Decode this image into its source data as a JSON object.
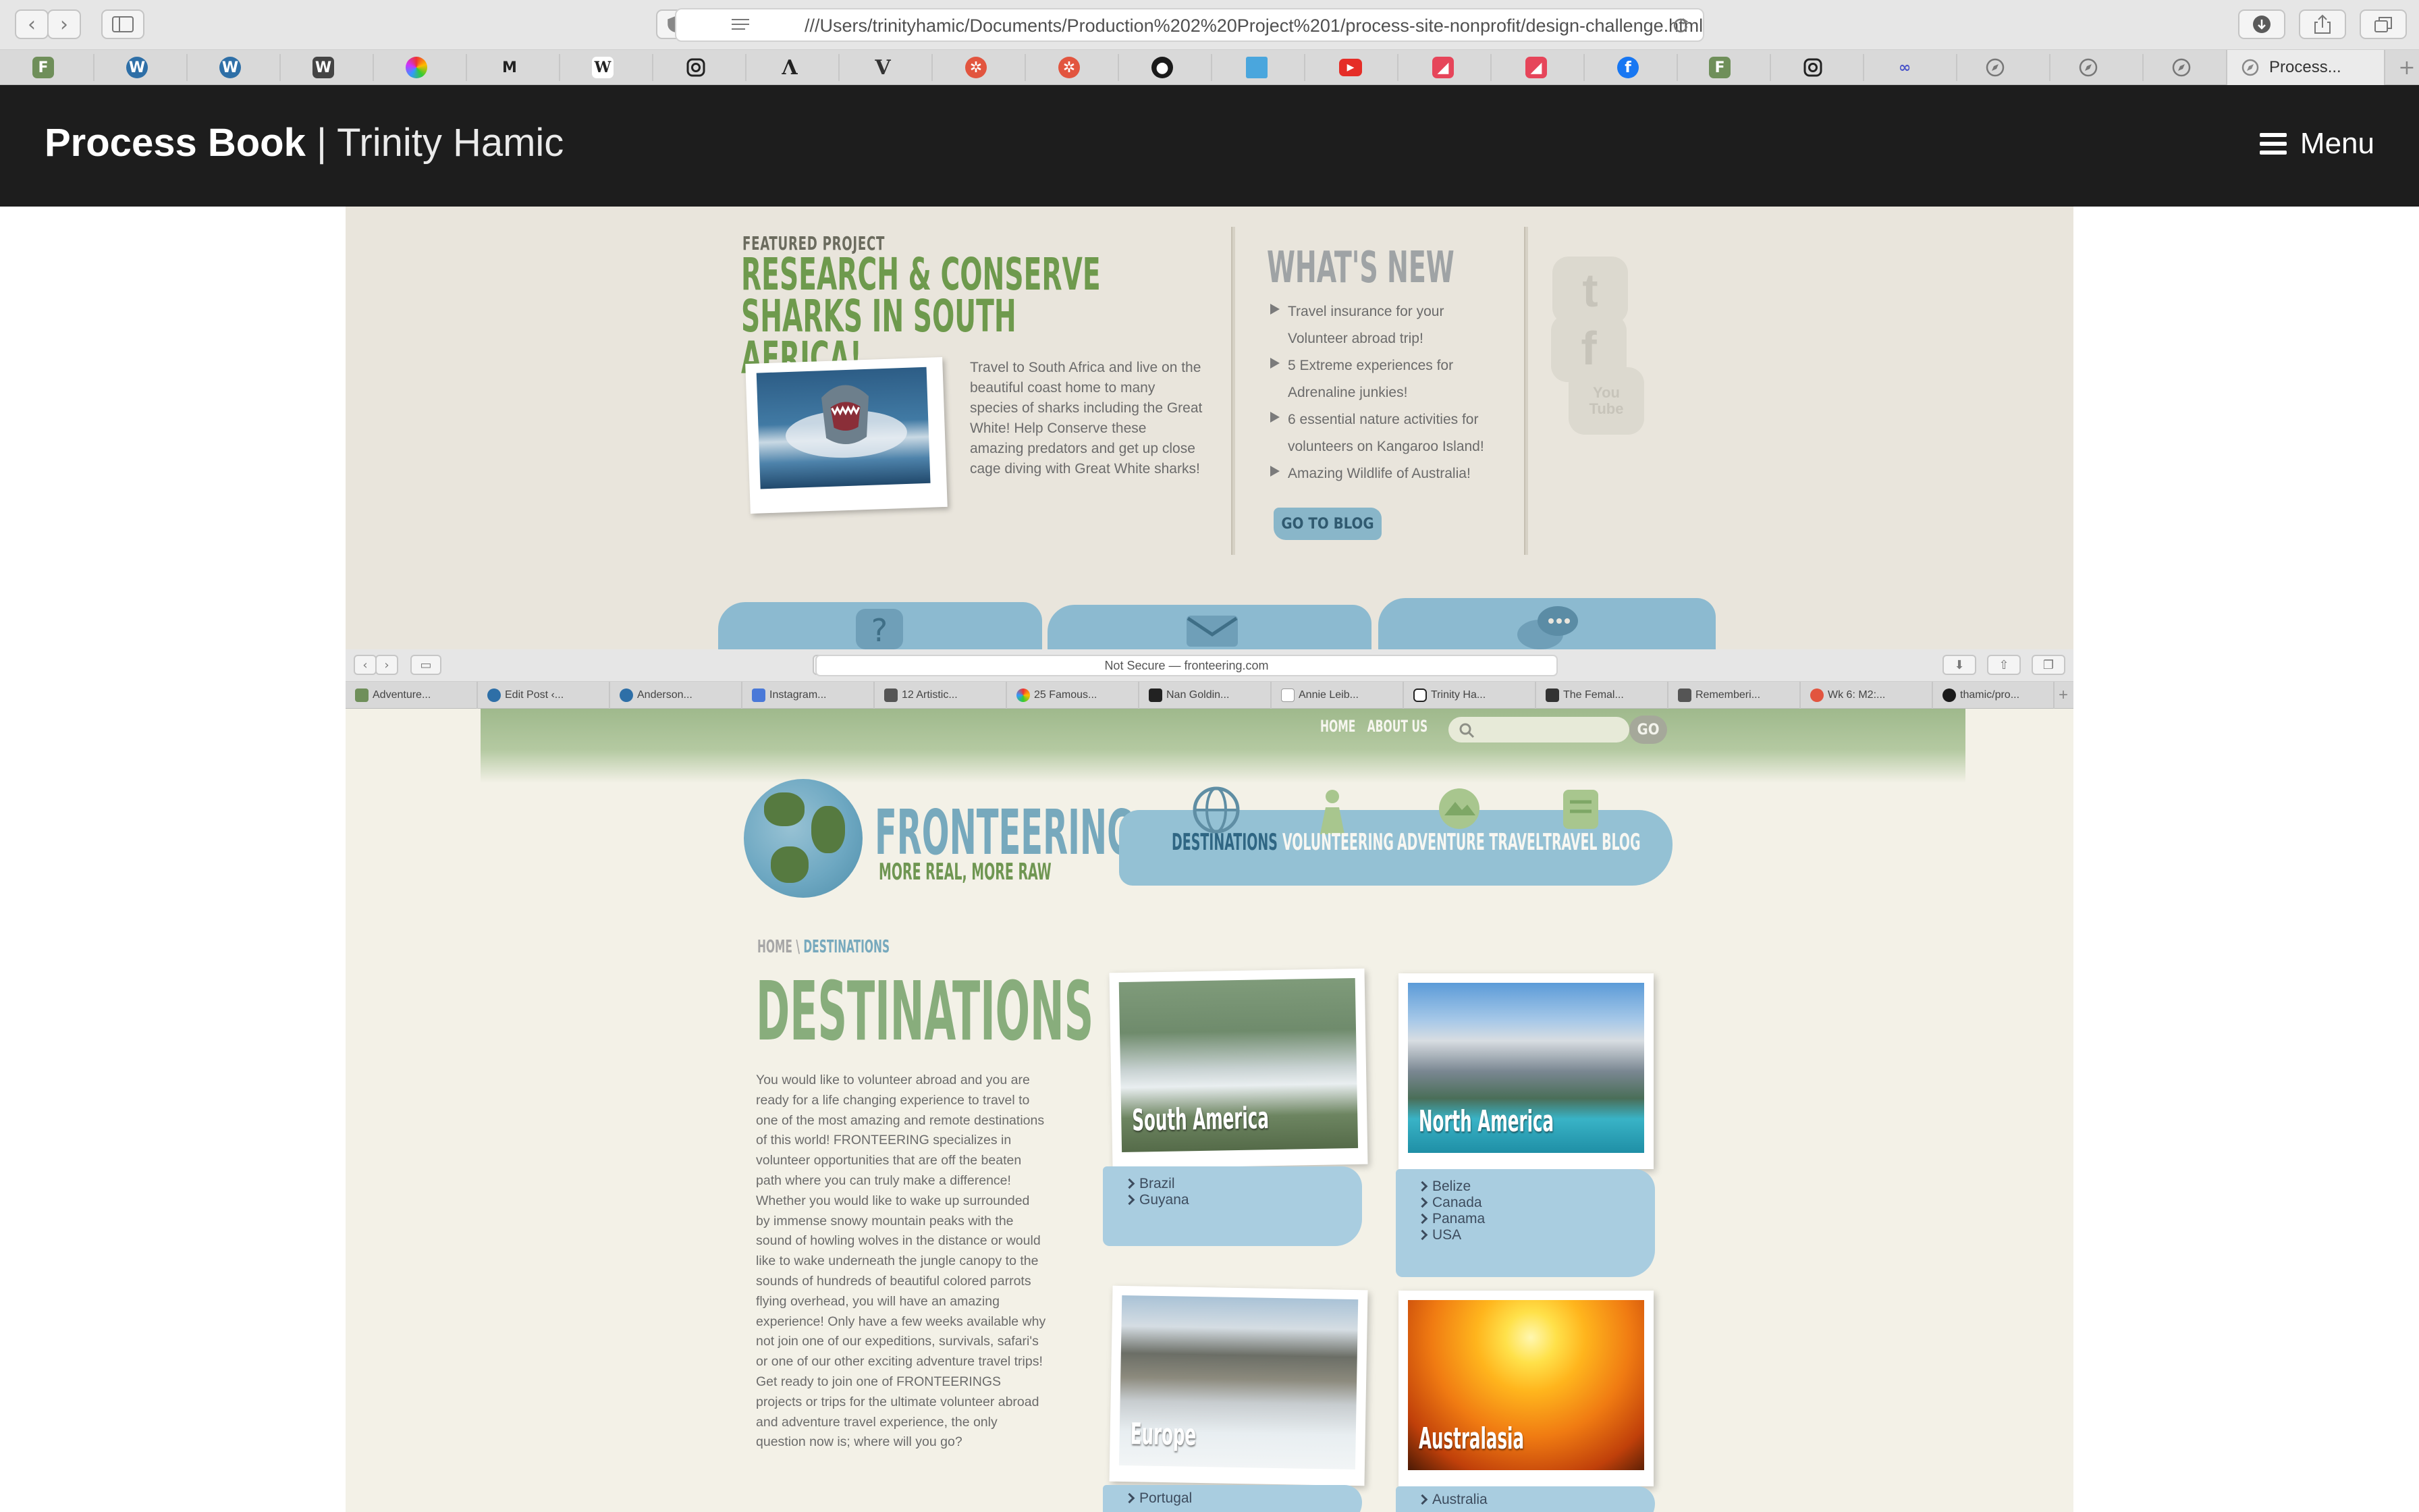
{
  "browser": {
    "url": "///Users/trinityhamic/Documents/Production%202%20Project%201/process-site-nonprofit/design-challenge.html",
    "active_tab_label": "Process...",
    "favorites": [
      "F",
      "W",
      "W",
      "W",
      "color",
      "M",
      "W",
      "ig",
      "A",
      "V",
      "compass-red",
      "compass-red",
      "github",
      "blue",
      "yt",
      "red",
      "red",
      "fb",
      "F",
      "ig",
      "link",
      "safari",
      "safari",
      "safari"
    ]
  },
  "header": {
    "title_bold": "Process Book",
    "separator": "|",
    "title_light": "Trinity Hamic",
    "menu_label": "Menu"
  },
  "featured": {
    "label": "FEATURED PROJECT",
    "title": "RESEARCH & CONSERVE SHARKS IN SOUTH AFRICA!",
    "body": "Travel to South Africa and live on the beautiful coast home to many species of sharks including the Great White! Help Conserve these amazing predators and get up close cage diving with Great White sharks!"
  },
  "whats_new": {
    "title": "WHAT'S NEW",
    "items": [
      "Travel insurance for your Volunteer abroad trip!",
      "5 Extreme experiences for Adrenaline junkies!",
      "6 essential nature activities for volunteers on Kangaroo Island!",
      "Amazing Wildlife of Australia!"
    ],
    "blog_button": "GO TO BLOG"
  },
  "social": {
    "youtube_line1": "You",
    "youtube_line2": "Tube",
    "twitter": "t",
    "facebook": "f"
  },
  "inner_browser": {
    "address": "Not Secure — fronteering.com",
    "tabs": [
      "Adventure...",
      "Edit Post ‹...",
      "Anderson...",
      "Instagram...",
      "12 Artistic...",
      "25 Famous...",
      "Nan Goldin...",
      "Annie Leib...",
      "Trinity Ha...",
      "The Femal...",
      "Rememberi...",
      "Wk 6: M2:...",
      "thamic/pro..."
    ]
  },
  "site": {
    "top_nav": [
      "HOME",
      "ABOUT US"
    ],
    "go_label": "GO",
    "brand": "FRONTEERING",
    "tagline": "MORE REAL, MORE RAW",
    "main_nav": [
      "DESTINATIONS",
      "VOLUNTEERING",
      "ADVENTURE TRAVEL",
      "TRAVEL BLOG"
    ],
    "breadcrumb": {
      "home": "HOME",
      "sep": "\\",
      "current": "DESTINATIONS"
    },
    "page_title": "DESTINATIONS",
    "intro": "You would like to volunteer abroad and you are ready for a life changing experience to travel to one of the most amazing and remote destinations of this world! FRONTEERING specializes in volunteer opportunities that are off the beaten path where you can truly make a difference! Whether you would like to wake up surrounded by immense snowy mountain peaks with the sound of howling wolves in the distance or would like to wake underneath the jungle canopy to the sounds of hundreds of beautiful colored parrots flying overhead, you will have an amazing experience! Only have a few weeks available why not join one of our expeditions, survivals, safari's or one of our other exciting adventure travel trips! Get ready to join one of FRONTEERINGS projects or trips for the ultimate volunteer abroad and adventure travel experience, the only question now is; where will you go?",
    "destinations": [
      {
        "name": "South America",
        "countries": [
          "Brazil",
          "Guyana"
        ]
      },
      {
        "name": "North America",
        "countries": [
          "Belize",
          "Canada",
          "Panama",
          "USA"
        ]
      },
      {
        "name": "Europe",
        "countries": [
          "Portugal"
        ]
      },
      {
        "name": "Australasia",
        "countries": [
          "Australia"
        ]
      }
    ]
  }
}
